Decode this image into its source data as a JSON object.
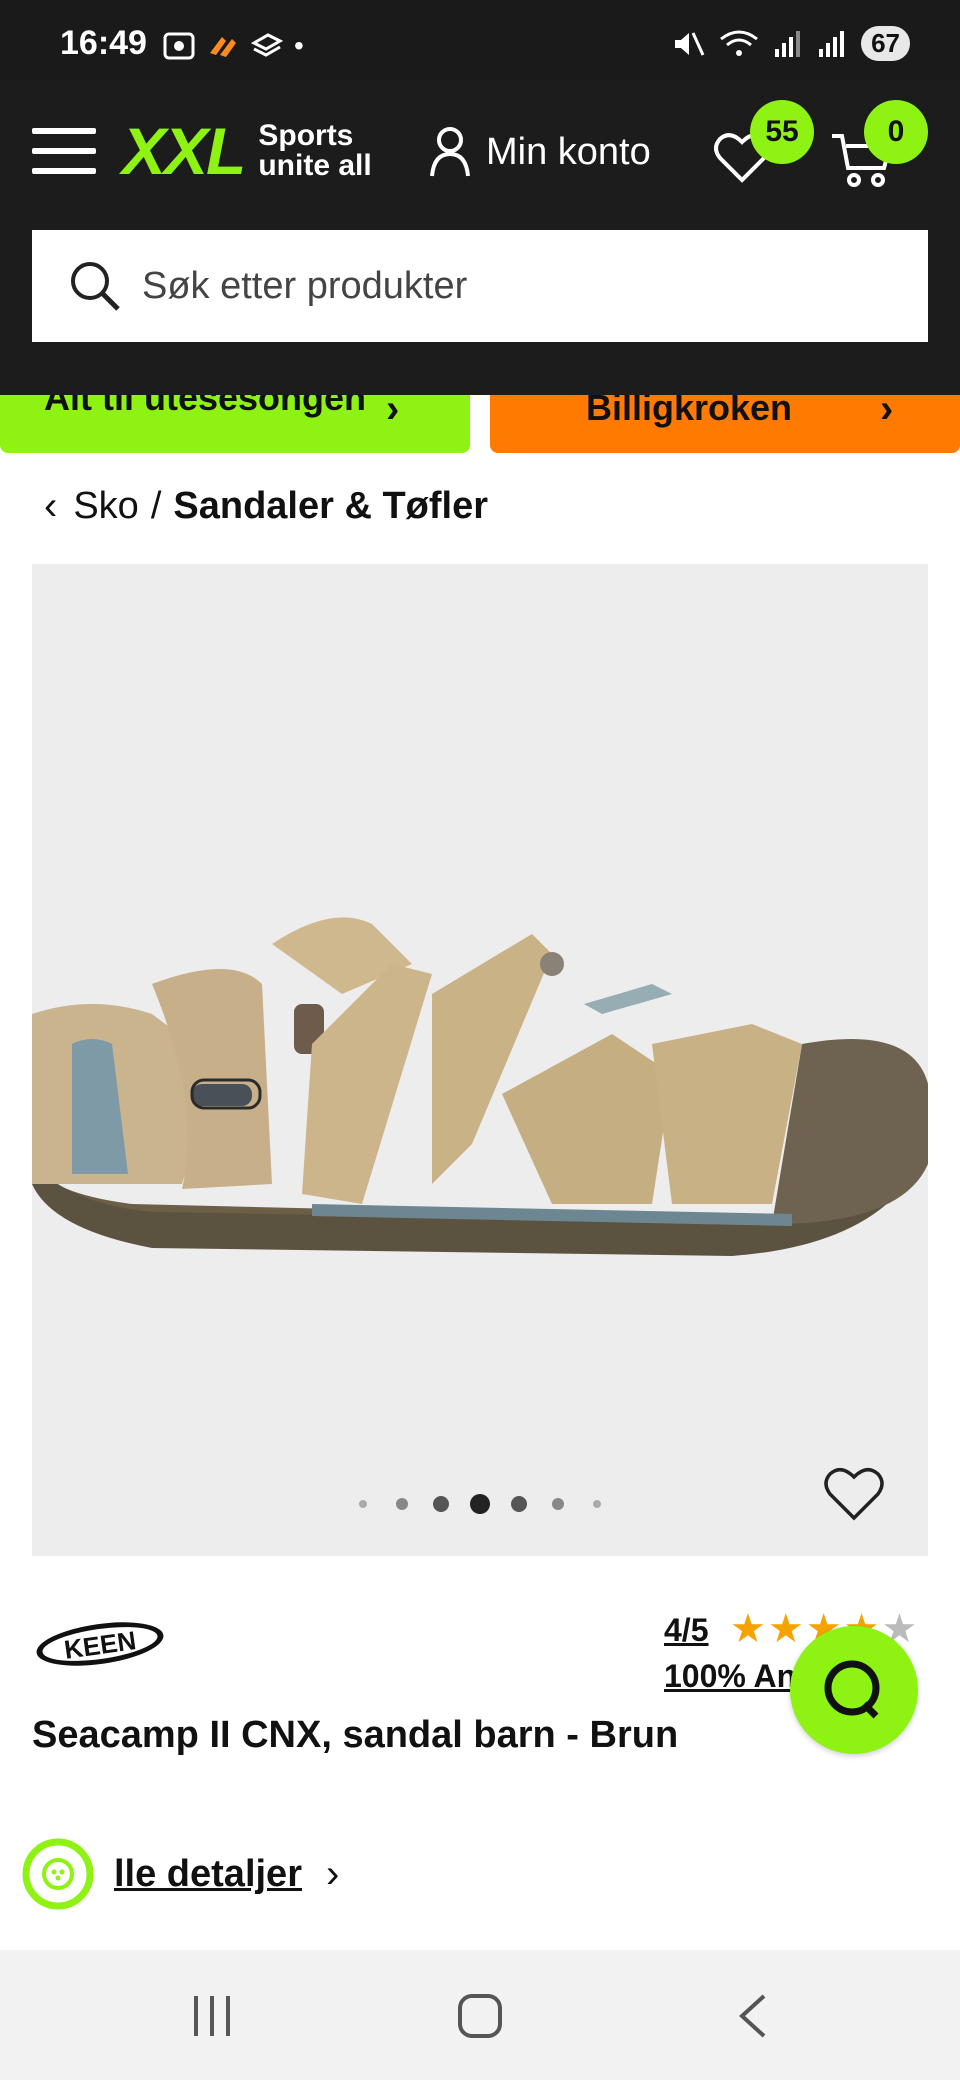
{
  "status_bar": {
    "time": "16:49",
    "battery": "67"
  },
  "header": {
    "logo_text": "XXL",
    "logo_tagline_1": "Sports",
    "logo_tagline_2": "unite all",
    "account_label": "Min konto",
    "wishlist_count": "55",
    "cart_count": "0",
    "search_placeholder": "Søk etter produkter"
  },
  "promos": {
    "left": "Alt til utesesongen",
    "right": "Billigkroken"
  },
  "breadcrumb": {
    "parent": "Sko",
    "separator": "/",
    "current": "Sandaler & Tøfler"
  },
  "gallery": {
    "dot_count": 7,
    "active_dot": 3
  },
  "product": {
    "brand": "KEEN",
    "rating_score": "4/5",
    "rating_value": 4,
    "rating_max": 5,
    "recommend_text": "100% Anbefaler",
    "title": "Seacamp II CNX, sandal barn - Brun",
    "details_link": "lle detaljer"
  },
  "colors": {
    "accent_green": "#8ef212",
    "accent_orange": "#fe7a00",
    "header_bg": "#1c1c1c",
    "star": "#f5a300"
  }
}
